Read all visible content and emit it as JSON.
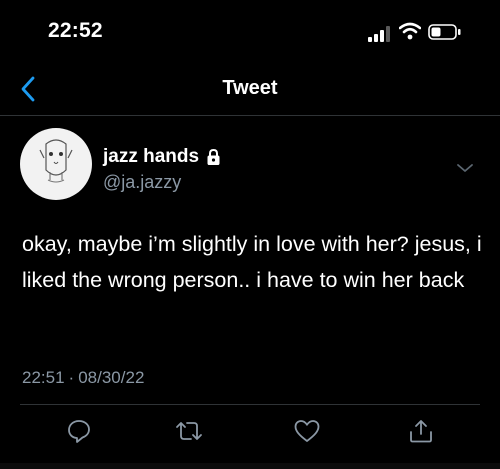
{
  "status_bar": {
    "time": "22:52"
  },
  "header": {
    "title": "Tweet"
  },
  "author": {
    "name": "jazz hands",
    "handle": "@ja.jazzy"
  },
  "tweet": {
    "text": "okay, maybe i’m slightly in love with her? jesus, i liked the wrong person.. i have to win her back",
    "time": "22:51",
    "separator": "·",
    "date": "08/30/22"
  },
  "actions": [
    "reply-icon",
    "retweet-icon",
    "like-icon",
    "share-icon"
  ],
  "colors": {
    "background": "#000000",
    "text": "#ffffff",
    "secondary": "#8b98a5",
    "accent": "#1d9bf0",
    "divider": "#2f3336"
  }
}
